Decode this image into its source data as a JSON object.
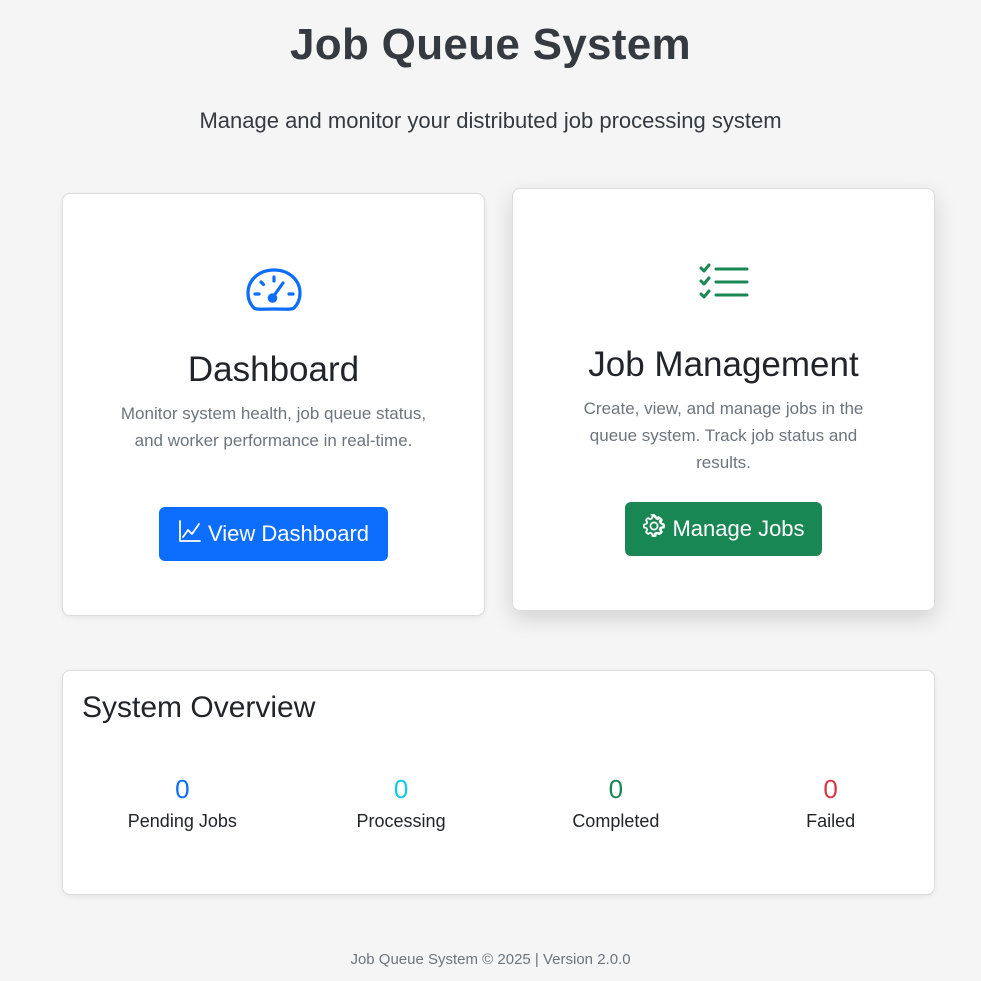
{
  "header": {
    "title": "Job Queue System",
    "subtitle": "Manage and monitor your distributed job processing system"
  },
  "cards": {
    "dashboard": {
      "icon": "speedometer-icon",
      "title": "Dashboard",
      "description": "Monitor system health, job queue status, and worker performance in real-time.",
      "button_icon": "line-chart-icon",
      "button_label": "View Dashboard",
      "accent": "#0d6efd"
    },
    "jobs": {
      "icon": "checklist-icon",
      "title": "Job Management",
      "description": "Create, view, and manage jobs in the queue system. Track job status and results.",
      "button_icon": "gear-icon",
      "button_label": "Manage Jobs",
      "accent": "#198754"
    }
  },
  "overview": {
    "title": "System Overview",
    "stats": [
      {
        "value": "0",
        "label": "Pending Jobs",
        "color": "#0d6efd"
      },
      {
        "value": "0",
        "label": "Processing",
        "color": "#0dcaf0"
      },
      {
        "value": "0",
        "label": "Completed",
        "color": "#198754"
      },
      {
        "value": "0",
        "label": "Failed",
        "color": "#dc3545"
      }
    ]
  },
  "footer": {
    "text": "Job Queue System © 2025 | Version 2.0.0"
  }
}
